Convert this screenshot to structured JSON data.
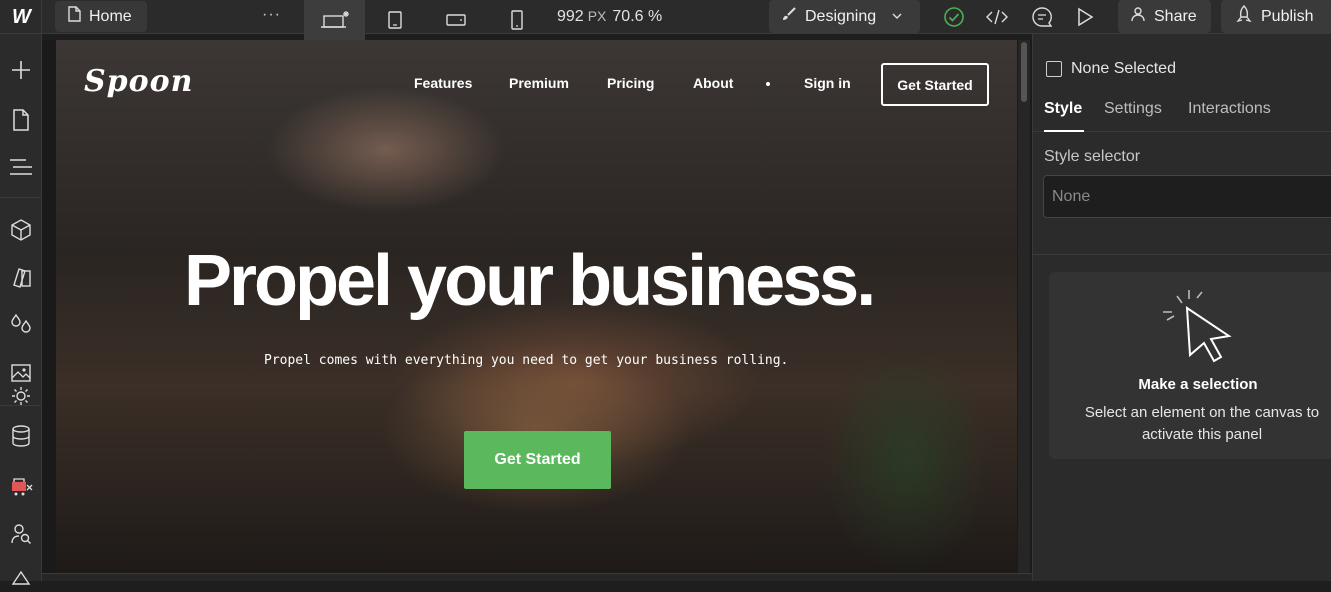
{
  "topbar": {
    "logo": "W",
    "page_name": "Home",
    "more": "···",
    "width_value": "992",
    "width_unit": "PX",
    "zoom": "70.6 %",
    "mode": "Designing",
    "share": "Share",
    "publish": "Publish"
  },
  "site": {
    "logo": "Spoon",
    "nav": [
      "Features",
      "Premium",
      "Pricing",
      "About",
      "Sign in"
    ],
    "nav_cta": "Get Started",
    "hero_title": "Propel your business.",
    "hero_subtitle": "Propel comes with everything you need to get your business rolling.",
    "hero_cta": "Get Started"
  },
  "panel": {
    "selection": "None Selected",
    "tabs": [
      "Style",
      "Settings",
      "Interactions"
    ],
    "selector_label": "Style selector",
    "selector_value": "None",
    "empty_title": "Make a selection",
    "empty_text": "Select an element on the canvas to activate this panel"
  },
  "colors": {
    "accent_green": "#5cb85c",
    "panel_bg": "#2b2b2b",
    "status_check": "#4caf50"
  }
}
